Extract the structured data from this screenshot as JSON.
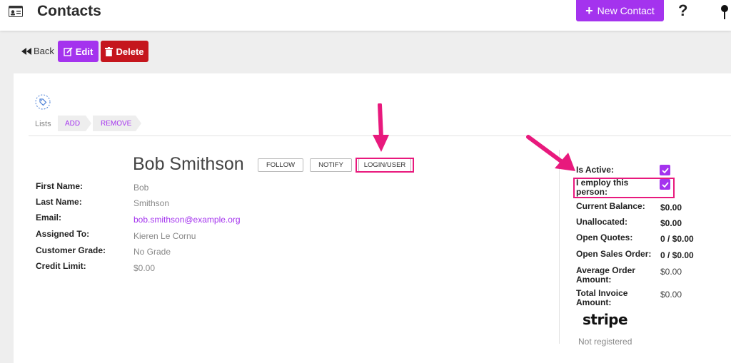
{
  "header": {
    "title": "Contacts",
    "new_contact_label": "New Contact",
    "help_symbol": "?"
  },
  "actions": {
    "back_label": "Back",
    "edit_label": "Edit",
    "delete_label": "Delete"
  },
  "lists": {
    "label": "Lists",
    "add_label": "ADD",
    "remove_label": "REMOVE"
  },
  "contact": {
    "name": "Bob Smithson",
    "follow_label": "FOLLOW",
    "notify_label": "NOTIFY",
    "login_label": "LOGIN/USER",
    "fields": [
      {
        "label": "First Name:",
        "value": "Bob"
      },
      {
        "label": "Last Name:",
        "value": "Smithson"
      },
      {
        "label": "Email:",
        "value": "bob.smithson@example.org"
      },
      {
        "label": "Assigned To:",
        "value": "Kieren Le Cornu"
      },
      {
        "label": "Customer Grade:",
        "value": "No Grade"
      },
      {
        "label": "Credit Limit:",
        "value": "$0.00"
      }
    ]
  },
  "summary": {
    "is_active_label": "Is Active:",
    "is_active": true,
    "employ_label": "I employ this person:",
    "employ": true,
    "current_balance_label": "Current Balance:",
    "current_balance": "$0.00",
    "unallocated_label": "Unallocated:",
    "unallocated": "$0.00",
    "open_quotes_label": "Open Quotes:",
    "open_quotes": "0 / $0.00",
    "open_sales_label": "Open Sales Order:",
    "open_sales": "0 / $0.00",
    "avg_order_label": "Average Order Amount:",
    "avg_order": "$0.00",
    "total_invoice_label": "Total Invoice Amount:",
    "total_invoice": "$0.00"
  },
  "stripe": {
    "logo_text": "stripe",
    "status": "Not registered"
  },
  "colors": {
    "accent": "#a433ee",
    "danger": "#c5161d",
    "annotation": "#e8197d"
  }
}
